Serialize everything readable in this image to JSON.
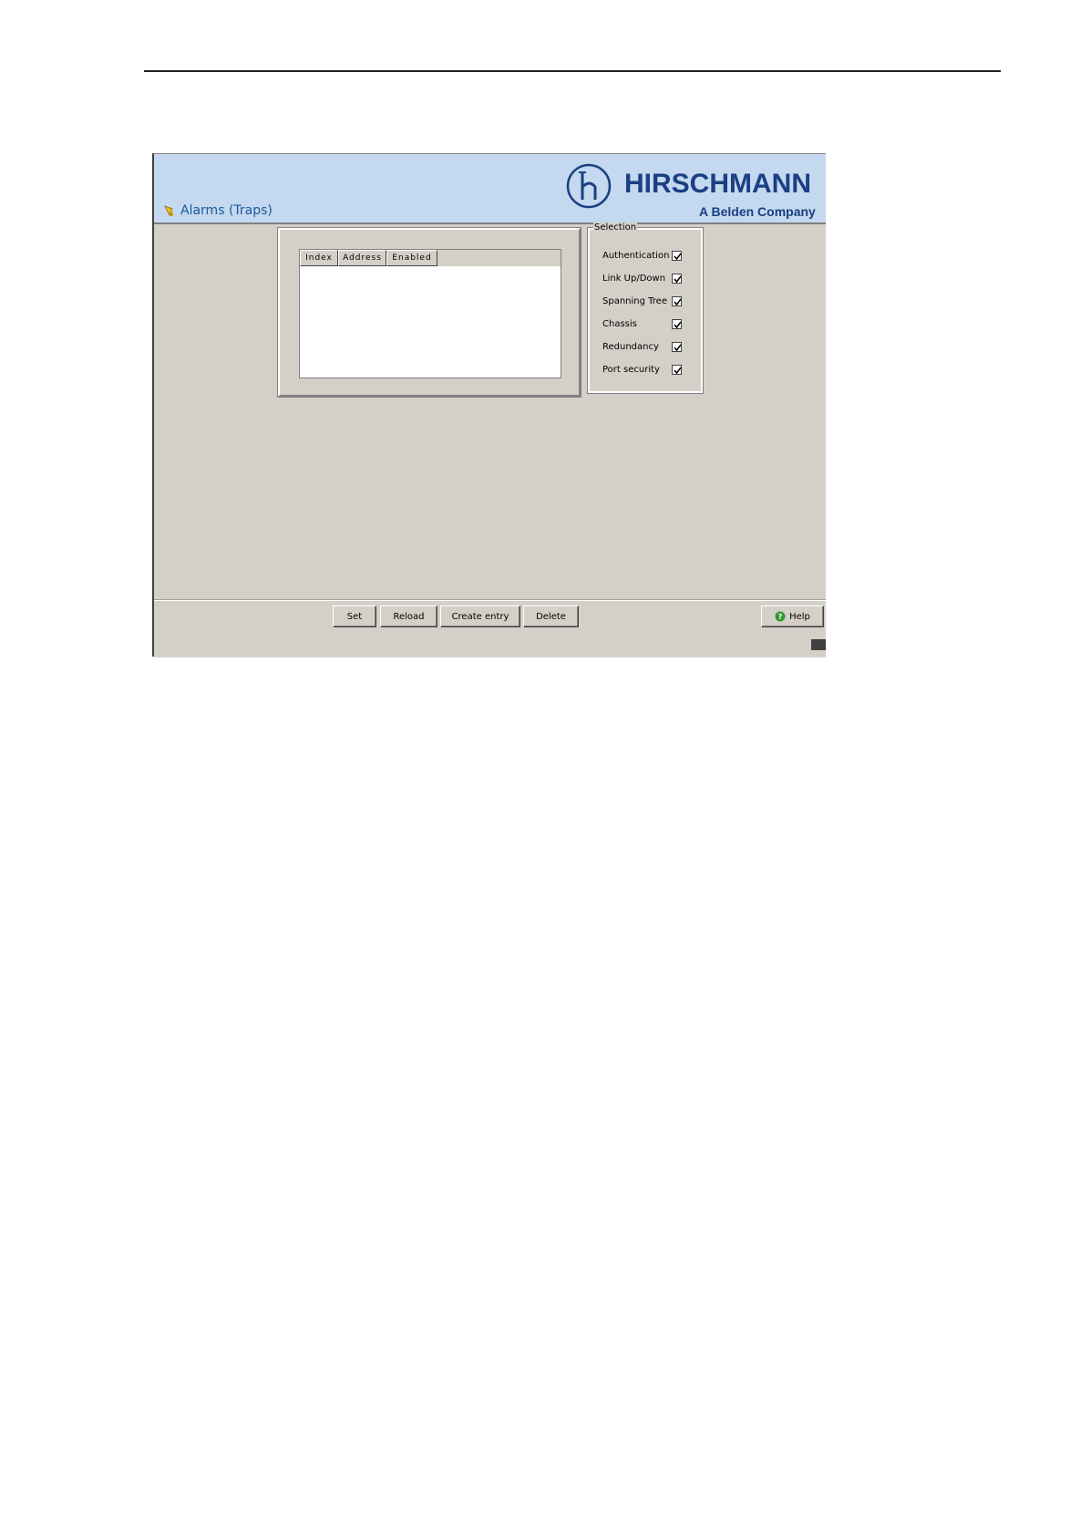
{
  "window": {
    "title": "Alarms (Traps)",
    "brand": "HIRSCHMANN",
    "tagline": "A Belden Company"
  },
  "table": {
    "columns": [
      "Index",
      "Address",
      "Enabled"
    ],
    "rows": []
  },
  "selection": {
    "legend": "Selection",
    "items": [
      {
        "label": "Authentication",
        "checked": true
      },
      {
        "label": "Link Up/Down",
        "checked": true
      },
      {
        "label": "Spanning Tree",
        "checked": true
      },
      {
        "label": "Chassis",
        "checked": true
      },
      {
        "label": "Redundancy",
        "checked": true
      },
      {
        "label": "Port security",
        "checked": true
      }
    ]
  },
  "buttons": {
    "set": "Set",
    "reload": "Reload",
    "create_entry": "Create entry",
    "delete": "Delete",
    "help": "Help"
  },
  "colors": {
    "header_bg": "#c4d8ef",
    "brand": "#1a3f82",
    "title": "#1a5a9a",
    "panel_bg": "#d4d0c8"
  }
}
